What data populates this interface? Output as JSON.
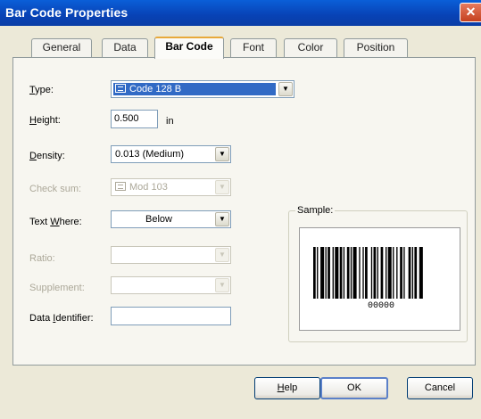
{
  "window": {
    "title": "Bar Code Properties",
    "close_glyph": "✕"
  },
  "tabs": [
    {
      "label": "General",
      "active": false
    },
    {
      "label": "Data",
      "active": false
    },
    {
      "label": "Bar Code",
      "active": true
    },
    {
      "label": "Font",
      "active": false
    },
    {
      "label": "Color",
      "active": false
    },
    {
      "label": "Position",
      "active": false
    }
  ],
  "form": {
    "type": {
      "label_ul": "T",
      "label_rest": "ype:",
      "value": "Code 128 B"
    },
    "height": {
      "label_ul": "H",
      "label_rest": "eight:",
      "value": "0.500",
      "unit": "in"
    },
    "density": {
      "label_ul": "D",
      "label_rest": "ensity:",
      "value": "0.013 (Medium)"
    },
    "check_sum": {
      "label": "Check sum:",
      "value": "Mod 103"
    },
    "text_where": {
      "label_pre": "Text ",
      "label_ul": "W",
      "label_rest": "here:",
      "value": "Below"
    },
    "ratio": {
      "label": "Ratio:",
      "value": ""
    },
    "supplement": {
      "label": "Supplement:",
      "value": ""
    },
    "data_identifier": {
      "label_pre": "Data ",
      "label_ul": "I",
      "label_rest": "dentifier:",
      "value": ""
    }
  },
  "sample": {
    "title": "Sample:",
    "barcode_text": "00000"
  },
  "buttons": {
    "help_ul": "H",
    "help_rest": "elp",
    "ok": "OK",
    "cancel": "Cancel"
  },
  "icons": {
    "combo_arrow": "▼",
    "type_icon": "printer-icon"
  },
  "colors": {
    "titlebar": "#0a4fcf",
    "selection": "#316ac5",
    "active_tab_accent": "#e8a93a"
  }
}
